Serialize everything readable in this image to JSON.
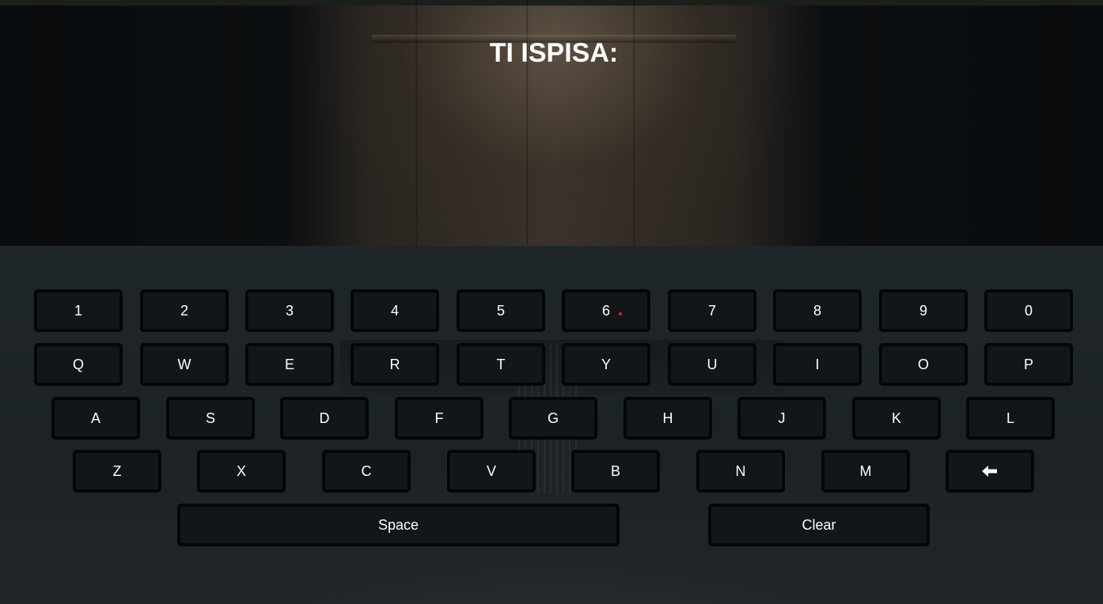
{
  "header": {
    "title": "TI ISPISA:",
    "typed_text": ""
  },
  "keyboard": {
    "row_numbers": [
      "1",
      "2",
      "3",
      "4",
      "5",
      "6",
      "7",
      "8",
      "9",
      "0"
    ],
    "row_q": [
      "Q",
      "W",
      "E",
      "R",
      "T",
      "Y",
      "U",
      "I",
      "O",
      "P"
    ],
    "row_a": [
      "A",
      "S",
      "D",
      "F",
      "G",
      "H",
      "J",
      "K",
      "L"
    ],
    "row_z": [
      "Z",
      "X",
      "C",
      "V",
      "B",
      "N",
      "M"
    ],
    "backspace_icon": "arrow-left-icon",
    "space_label": "Space",
    "clear_label": "Clear"
  },
  "colors": {
    "key_bg": "#12161a",
    "key_border": "#050607",
    "text": "#ffffff",
    "cursor": "#e02020"
  }
}
